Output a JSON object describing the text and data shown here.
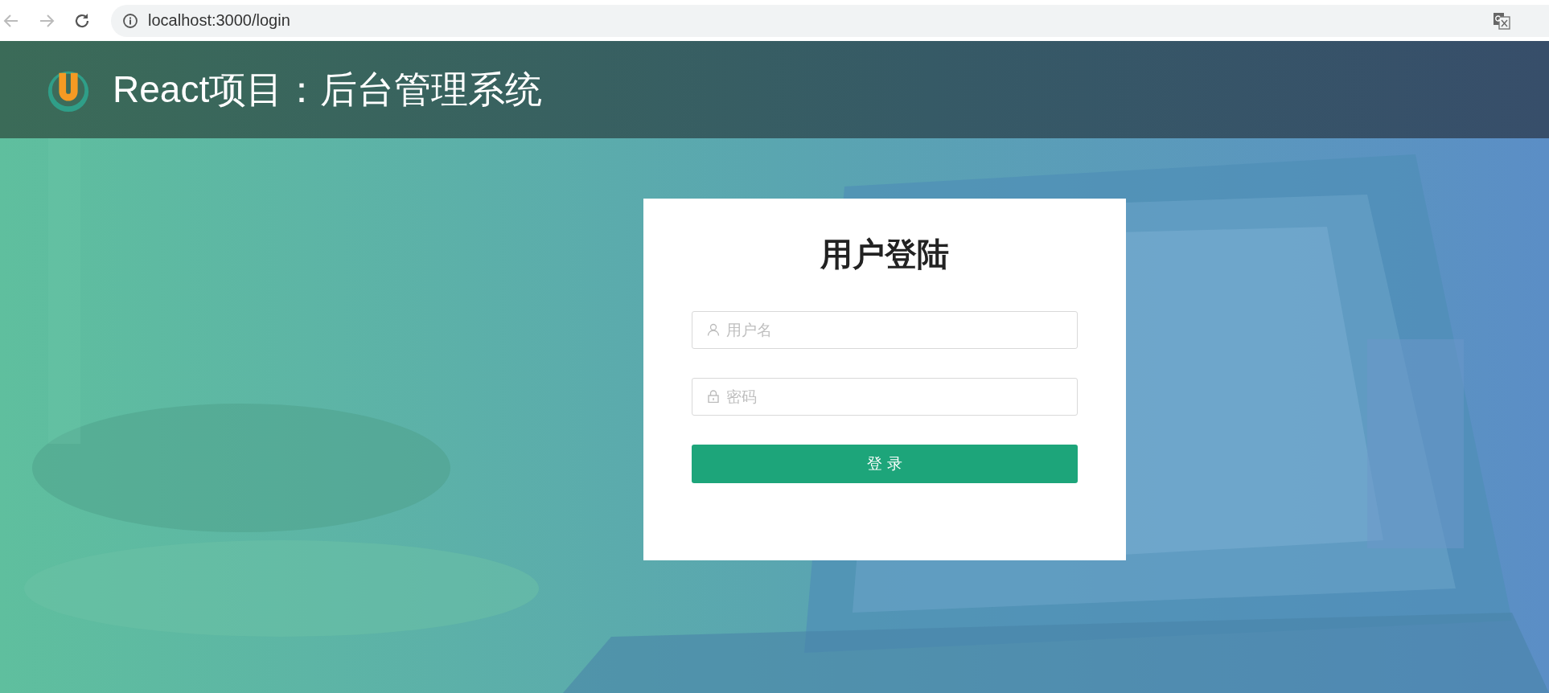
{
  "browser": {
    "url": "localhost:3000/login"
  },
  "header": {
    "title": "React项目：后台管理系统"
  },
  "login": {
    "title": "用户登陆",
    "fields": [
      {
        "kind": "user",
        "placeholder": "用户名"
      },
      {
        "kind": "password",
        "placeholder": "密码"
      }
    ],
    "submit": "登 录"
  }
}
